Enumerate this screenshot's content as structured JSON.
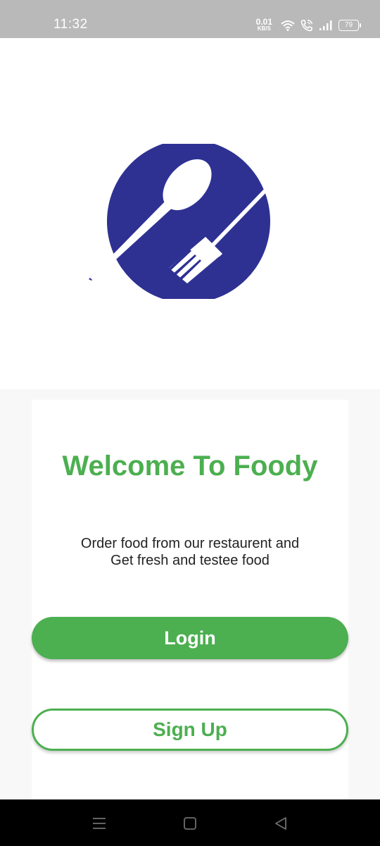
{
  "status_bar": {
    "time": "11:32",
    "net_speed_value": "0.01",
    "net_speed_unit": "KB/S",
    "battery": "79",
    "icons": [
      "wifi-icon",
      "call-icon",
      "signal-icon",
      "battery-icon"
    ]
  },
  "logo": {
    "icon": "spoon-fork-logo",
    "color": "#2e3192"
  },
  "welcome": {
    "title": "Welcome To Foody",
    "subtitle_line1": "Order food from our restaurent and",
    "subtitle_line2": "Get fresh and testee food"
  },
  "buttons": {
    "login_label": "Login",
    "signup_label": "Sign Up"
  },
  "colors": {
    "accent": "#4caf50",
    "status_bar": "#b9b9b9",
    "brand": "#2e3192"
  },
  "nav_bar": {
    "icons": [
      "menu-icon",
      "home-icon",
      "back-icon"
    ]
  }
}
